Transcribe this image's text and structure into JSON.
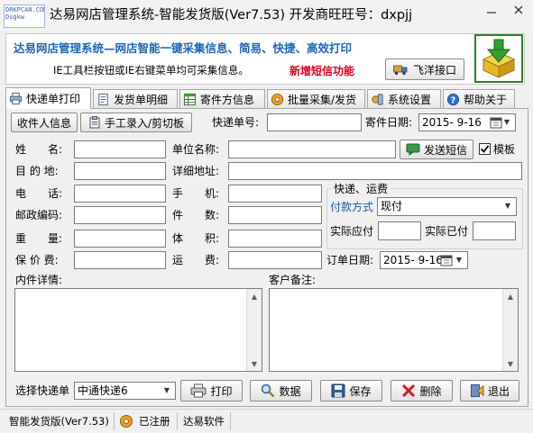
{
  "window": {
    "title": "达易网店管理系统-智能发货版(Ver7.53) 开发商旺旺号：dxpjj",
    "logo_text": "DRKPCAN.COM Dsgkw"
  },
  "banner": {
    "headline": "达易网店管理系统—网店智能一键采集信息、简易、快捷、高效打印",
    "tip": "IE工具栏按钮或IE右键菜单均可采集信息。",
    "sms_feature": "新增短信功能",
    "feixiang_button": "飞洋接口"
  },
  "tabs": [
    {
      "label": "快递单打印",
      "icon": "printer-icon",
      "active": true
    },
    {
      "label": "发货单明细",
      "icon": "document-icon",
      "active": false
    },
    {
      "label": "寄件方信息",
      "icon": "grid-icon",
      "active": false
    },
    {
      "label": "批量采集/发货",
      "icon": "gear-icon",
      "active": false
    },
    {
      "label": "系统设置",
      "icon": "settings-icon",
      "active": false
    },
    {
      "label": "帮助关于",
      "icon": "help-icon",
      "active": false
    }
  ],
  "form": {
    "recipient_info_button": "收件人信息",
    "manual_entry_button": "手工录入/剪切板",
    "tracking_no_label": "快递单号:",
    "tracking_no_value": "",
    "ship_date_label": "寄件日期:",
    "ship_date_value": "2015- 9-16",
    "name_label": "姓　　名:",
    "company_label": "单位名称:",
    "send_sms_button": "发送短信",
    "template_label": "模板",
    "template_checked": true,
    "destination_label": "目 的 地:",
    "address_label": "详细地址:",
    "phone_label": "电　　话:",
    "mobile_label": "手　　机:",
    "zipcode_label": "邮政编码:",
    "pieces_label": "件　　数:",
    "weight_label": "重　　量:",
    "volume_label": "体　　积:",
    "insured_label": "保 价 费:",
    "freight_label": "运　　费:",
    "order_date_label": "订单日期:",
    "order_date_value": "2015- 9-16",
    "content_label": "内件详情:",
    "customer_note_label": "客户备注:"
  },
  "fees_group": {
    "title": "快递、运费",
    "payment_method_label": "付款方式",
    "payment_method_value": "现付",
    "actual_due_label": "实际应付",
    "actual_paid_label": "实际已付"
  },
  "bottom": {
    "select_courier_label": "选择快递单",
    "courier_value": "中通快递6",
    "print_button": "打印",
    "data_button": "数据",
    "save_button": "保存",
    "delete_button": "删除",
    "exit_button": "退出"
  },
  "statusbar": {
    "version": "智能发货版(Ver7.53)",
    "registered": "已注册",
    "company": "达易软件"
  },
  "colors": {
    "headline_blue": "#1a66b8",
    "sms_red": "#e0001a",
    "logo_green": "#2f7d2a"
  }
}
